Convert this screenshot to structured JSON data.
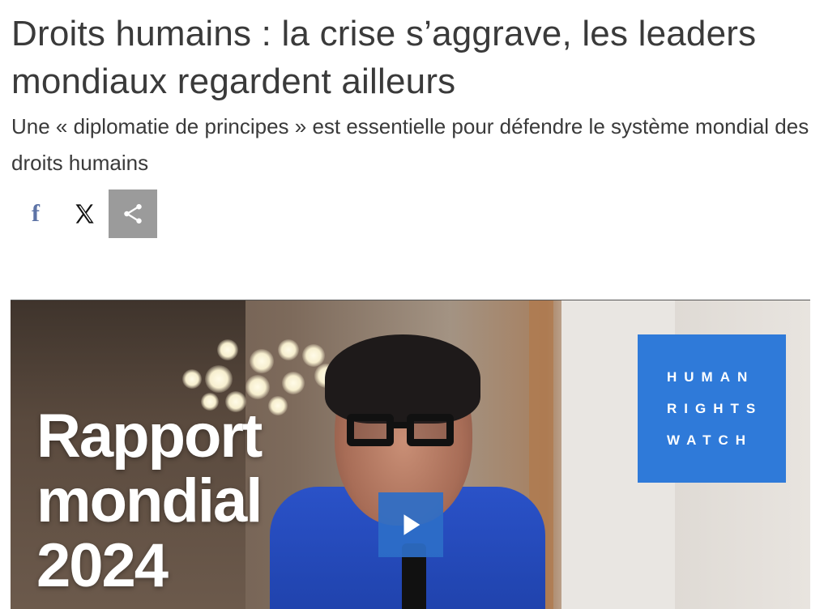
{
  "article": {
    "headline": "Droits humains : la crise s’aggrave, les leaders mondiaux regardent ailleurs",
    "subtitle": "Une « diplomatie de principes » est essentielle pour défendre le système mondial des droits humains"
  },
  "share": {
    "facebook_glyph": "f",
    "icons": [
      "facebook-icon",
      "x-icon",
      "share-icon"
    ]
  },
  "video": {
    "title_lines": [
      "Rapport",
      "mondial",
      "2024"
    ],
    "logo_lines": [
      "HUMAN",
      "RIGHTS",
      "WATCH"
    ],
    "colors": {
      "logo_bg": "#2f7ad9",
      "play_bg": "#2d6ec8",
      "share_active_bg": "#9b9b9b",
      "facebook": "#5d73a6"
    }
  }
}
